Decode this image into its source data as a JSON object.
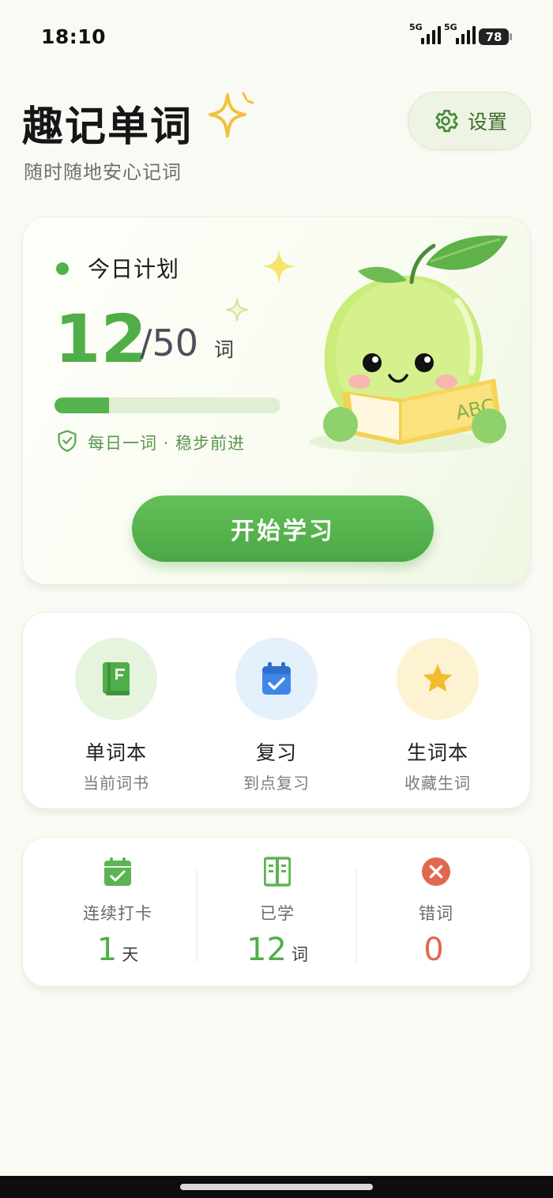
{
  "status_bar": {
    "time": "18:10",
    "network_1": "5G",
    "network_2": "5G",
    "battery": "78"
  },
  "header": {
    "title": "趣记单词",
    "subtitle": "随时随地安心记词",
    "settings_label": "设置",
    "settings_icon": "gear-icon",
    "title_icon": "sparkle-icon"
  },
  "plan": {
    "title": "今日计划",
    "learned": "12",
    "total": "/50",
    "unit": "词",
    "progress": 0.24,
    "motto": "每日一词 · 稳步前进",
    "start_label": "开始学习",
    "mascot_book_text": "ABC"
  },
  "shortcuts": [
    {
      "name": "单词本",
      "desc": "当前词书",
      "icon": "book-icon",
      "bg": "#e6f4dd",
      "color": "#4fae48"
    },
    {
      "name": "复习",
      "desc": "到点复习",
      "icon": "calendar-check-icon",
      "bg": "#e5f0fd",
      "color": "#3f86e8"
    },
    {
      "name": "生词本",
      "desc": "收藏生词",
      "icon": "star-icon",
      "bg": "#fdf3d2",
      "color": "#f2bd2c"
    }
  ],
  "stats": [
    {
      "label": "连续打卡",
      "value": "1",
      "unit": "天",
      "icon": "calendar-check-icon",
      "color": "#4fae48"
    },
    {
      "label": "已学",
      "value": "12",
      "unit": "词",
      "icon": "open-book-icon",
      "color": "#4fae48"
    },
    {
      "label": "错词",
      "value": "0",
      "unit": "",
      "icon": "close-circle-icon",
      "color": "#e2674f"
    }
  ],
  "colors": {
    "accent": "#4fae48",
    "background": "#f9faf4"
  }
}
